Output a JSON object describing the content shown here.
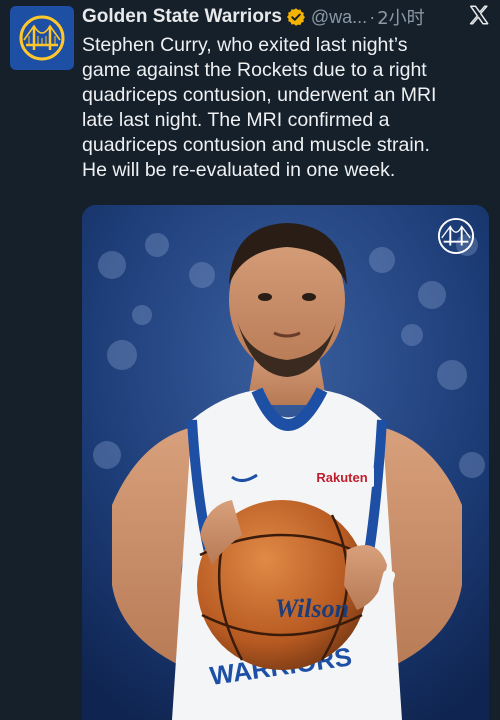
{
  "author": {
    "display_name": "Golden State Warriors",
    "handle": "@wa...",
    "separator": "·",
    "timestamp": "2小时",
    "verified": true,
    "avatar_icon": "warriors-bridge-logo-icon"
  },
  "tweet": {
    "text": "Stephen Curry, who exited last night’s\ngame against the Rockets due to a right\nquadriceps contusion, underwent an MRI\nlate last night. The MRI confirmed a\nquadriceps contusion and muscle strain.\nHe will be re-evaluated in one week."
  },
  "media": {
    "jersey_sponsor": "Rakuten",
    "jersey_team": "WARRIORS",
    "ball_brand": "Wilson",
    "watermark_icon": "warriors-bridge-logo-icon"
  },
  "colors": {
    "background": "#15202b",
    "text": "#e7e9ea",
    "muted": "#8b98a5",
    "verified_badge": "#f5b301",
    "warriors_blue": "#1d4fa5",
    "warriors_gold": "#ffc72c"
  }
}
